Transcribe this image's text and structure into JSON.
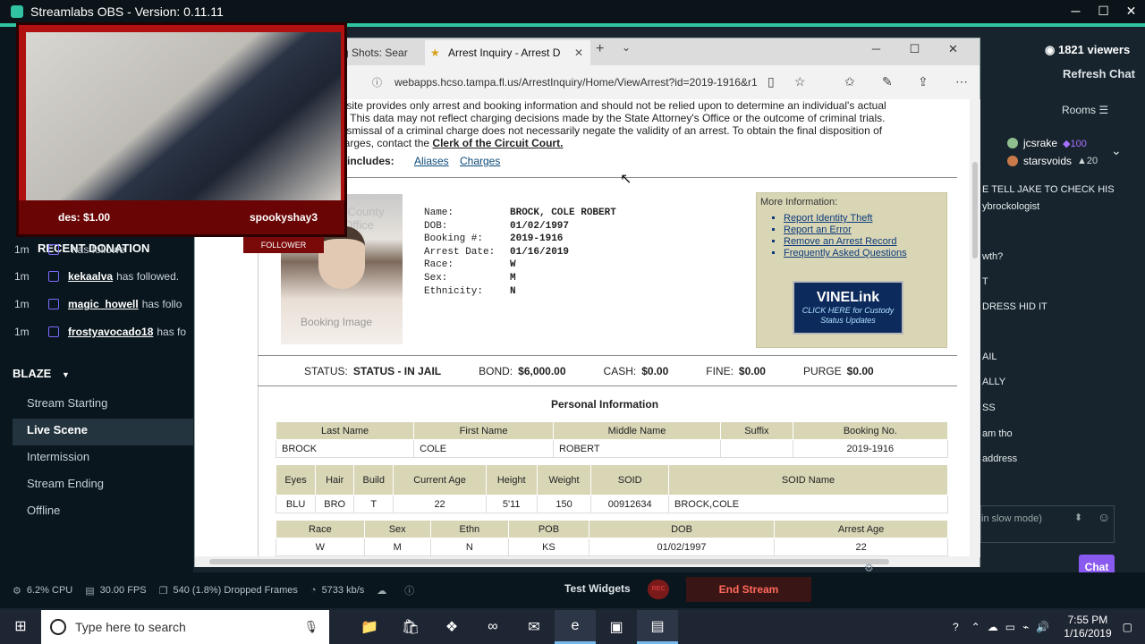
{
  "app": {
    "title": "Streamlabs OBS - Version: 0.11.11"
  },
  "window_controls": {
    "minimize": "─",
    "maximize": "☐",
    "close": "✕"
  },
  "camera": {
    "donation": "des: $1.00",
    "username": "spookyshay3",
    "follower_tag": "FOLLOWER"
  },
  "events": {
    "recent_donation": "RECENT DONATION",
    "items": [
      {
        "time": "1m",
        "name": "",
        "action": "has followe"
      },
      {
        "time": "1m",
        "name": "kekaalva",
        "action": "has followed."
      },
      {
        "time": "1m",
        "name": "magic_howell",
        "action": "has follo"
      },
      {
        "time": "1m",
        "name": "frostyavocado18",
        "action": "has fo"
      }
    ]
  },
  "scene_collection": {
    "name": "BLAZE",
    "scenes": [
      "Stream Starting",
      "Live Scene",
      "Intermission",
      "Stream Ending",
      "Offline"
    ],
    "active": "Live Scene"
  },
  "browser": {
    "tab1": "g Shots: Sear",
    "tab2": "Arrest Inquiry - Arrest D",
    "url": "webapps.hcso.tampa.fl.us/ArrestInquiry/Home/ViewArrest?id=2019-1916&r1",
    "notice_lines": [
      "s site provides only arrest and booking information and should not be relied upon to determine an individual's actual",
      "d. This data may not reflect charging decisions made by the State Attorney's Office or the outcome of criminal trials.",
      "dismissal of a criminal charge does not necessarily negate the validity of an arrest. To obtain the final disposition of",
      "harges, contact the "
    ],
    "clerk_link": "Clerk of the Circuit Court.",
    "includes_label": "includes:",
    "links": [
      "Aliases",
      "Charges"
    ],
    "mug_watermark": "Booking Image",
    "mug_agency": "m County\ns Office",
    "arrest": {
      "name_k": "Name:",
      "name": "BROCK, COLE ROBERT",
      "dob_k": "DOB:",
      "dob": "01/02/1997",
      "booking_k": "Booking #:",
      "booking": "2019-1916",
      "arrest_date_k": "Arrest Date:",
      "arrest_date": "01/16/2019",
      "race_k": "Race:",
      "race": "W",
      "sex_k": "Sex:",
      "sex": "M",
      "eth_k": "Ethnicity:",
      "eth": "N"
    },
    "more_info": {
      "heading": "More Information:",
      "links": [
        "Report Identity Theft",
        "Report an Error",
        "Remove an Arrest Record",
        "Frequently Asked Questions"
      ],
      "vine_title": "VINELink",
      "vine_sub": "CLICK HERE for Custody Status Updates"
    },
    "status": {
      "status_k": "STATUS:",
      "status": "STATUS - IN JAIL",
      "bond_k": "BOND:",
      "bond": "$6,000.00",
      "cash_k": "CASH:",
      "cash": "$0.00",
      "fine_k": "FINE:",
      "fine": "$0.00",
      "purge_k": "PURGE",
      "purge": "$0.00"
    },
    "personal_heading": "Personal Information",
    "table1": {
      "headers": [
        "Last Name",
        "First Name",
        "Middle Name",
        "Suffix",
        "Booking No."
      ],
      "row": [
        "BROCK",
        "COLE",
        "ROBERT",
        "",
        "2019-1916"
      ]
    },
    "table2": {
      "headers": [
        "Eyes",
        "Hair",
        "Build",
        "Current Age",
        "Height",
        "Weight",
        "SOID",
        "SOID Name"
      ],
      "row": [
        "BLU",
        "BRO",
        "T",
        "22",
        "5'11",
        "150",
        "00912634",
        "BROCK,COLE"
      ]
    },
    "table3": {
      "headers": [
        "Race",
        "Sex",
        "Ethn",
        "POB",
        "DOB",
        "Arrest Age"
      ],
      "row": [
        "W",
        "M",
        "N",
        "KS",
        "01/02/1997",
        "22"
      ]
    }
  },
  "chat": {
    "viewers": "1821 viewers",
    "refresh": "Refresh Chat",
    "rooms": "Rooms",
    "chatters": [
      {
        "name": "jcsrake",
        "count": "100",
        "color": "#a970ff"
      },
      {
        "name": "starsvoids",
        "count": "20",
        "color": "#e0e0e0"
      }
    ],
    "lines": [
      "E TELL JAKE TO CHECK HIS",
      "ybrockologist",
      "wth?",
      "T",
      "DRESS HID IT",
      "AIL",
      "ALLY",
      "SS",
      "am tho",
      "address"
    ],
    "input_placeholder": "in slow mode)",
    "chat_button": "Chat"
  },
  "statusbar": {
    "cpu": "6.2% CPU",
    "fps": "30.00 FPS",
    "dropped": "540 (1.8%) Dropped Frames",
    "bitrate": "5733 kb/s",
    "test_widgets": "Test Widgets",
    "rec": "REC",
    "end_stream": "End Stream"
  },
  "taskbar": {
    "search_placeholder": "Type here to search",
    "time": "7:55 PM",
    "date": "1/16/2019"
  },
  "colors": {
    "accent": "#31c3a2",
    "end_stream": "#ff6a5b",
    "chat_button": "#8a59f0"
  }
}
